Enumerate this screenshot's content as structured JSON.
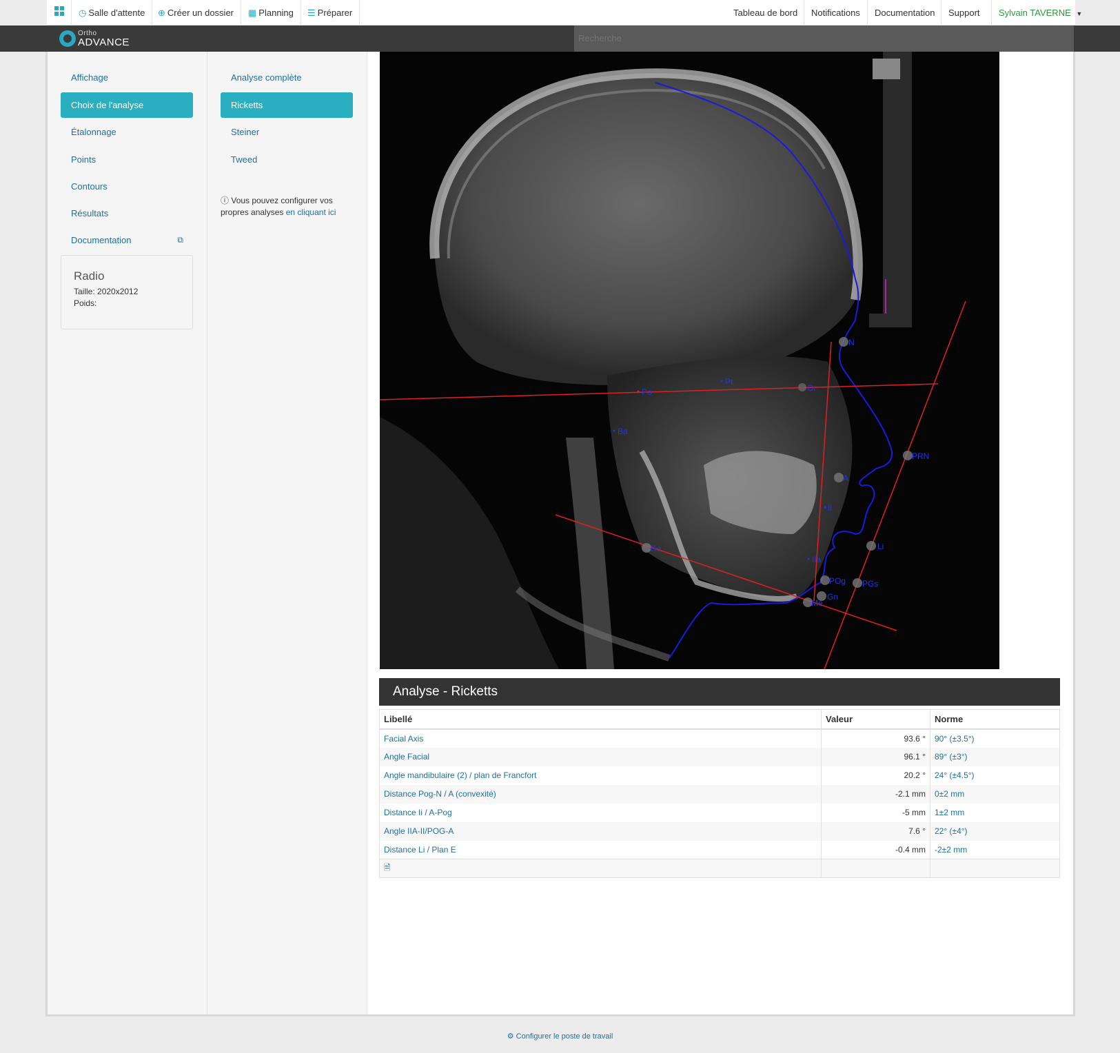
{
  "topnav": {
    "waiting_room": "Salle d'attente",
    "create_file": "Créer un dossier",
    "planning": "Planning",
    "prepare": "Préparer",
    "dashboard": "Tableau de bord",
    "notifications": "Notifications",
    "documentation": "Documentation",
    "support": "Support",
    "user": "Sylvain TAVERNE"
  },
  "logo": {
    "line1": "Ortho",
    "line2": "ADVANCE"
  },
  "search": {
    "placeholder": "Recherche"
  },
  "sidebar": {
    "items": [
      {
        "label": "Affichage",
        "active": false
      },
      {
        "label": "Choix de l'analyse",
        "active": true
      },
      {
        "label": "Étalonnage",
        "active": false
      },
      {
        "label": "Points",
        "active": false
      },
      {
        "label": "Contours",
        "active": false
      },
      {
        "label": "Résultats",
        "active": false
      },
      {
        "label": "Documentation",
        "active": false
      }
    ]
  },
  "radio": {
    "title": "Radio",
    "size": "Taille: 2020x2012",
    "weight": "Poids:"
  },
  "analyses": {
    "items": [
      {
        "label": "Analyse complète",
        "active": false
      },
      {
        "label": "Ricketts",
        "active": true
      },
      {
        "label": "Steiner",
        "active": false
      },
      {
        "label": "Tweed",
        "active": false
      }
    ],
    "info_text": "Vous pouvez configurer vos propres analyses",
    "info_link": "en cliquant ici"
  },
  "landmarks": {
    "po": "Po",
    "pt": "Pt",
    "or": "Or",
    "ba": "Ba",
    "n": "N",
    "prn": "PRN",
    "a": "A",
    "ii": "Ii",
    "go": "Go",
    "li": "Li",
    "iia": "IIa",
    "pog": "POg",
    "pgs": "PGs",
    "gn": "Gn",
    "me": "Me"
  },
  "analysis": {
    "title": "Analyse - Ricketts",
    "headers": {
      "label": "Libellé",
      "value": "Valeur",
      "norm": "Norme"
    },
    "rows": [
      {
        "label": "Facial Axis",
        "value": "93.6  °",
        "norm": "90° (±3.5°)"
      },
      {
        "label": "Angle Facial",
        "value": "96.1  °",
        "norm": "89° (±3°)"
      },
      {
        "label": "Angle mandibulaire (2) / plan de Francfort",
        "value": "20.2  °",
        "norm": "24° (±4.5°)"
      },
      {
        "label": "Distance Pog-N / A (convexité)",
        "value": "-2.1  mm",
        "norm": "0±2 mm"
      },
      {
        "label": "Distance Ii / A-Pog",
        "value": "-5  mm",
        "norm": "1±2 mm"
      },
      {
        "label": "Angle IIA-II/POG-A",
        "value": "7.6  °",
        "norm": "22° (±4°)"
      },
      {
        "label": "Distance Li / Plan E",
        "value": "-0.4  mm",
        "norm": "-2±2 mm"
      }
    ]
  },
  "footer": {
    "configure": "Configurer le poste de travail"
  },
  "colors": {
    "accent": "#29afc0",
    "link": "#1f6f9a",
    "user": "#2a9a3a",
    "tracing_red": "#e0201e",
    "tracing_blue": "#1a1ae0"
  }
}
